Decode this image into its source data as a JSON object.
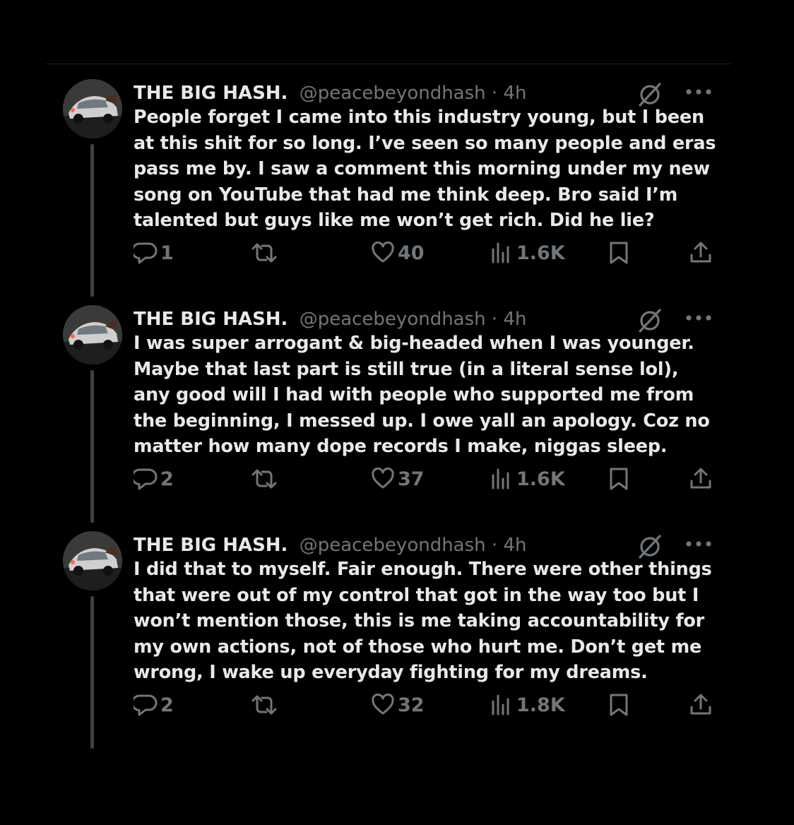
{
  "tweets": [
    {
      "name": "THE BIG HASH.",
      "handle": "@peacebeyondhash",
      "separator": "·",
      "time": "4h",
      "text": "People forget I came into this industry young, but I been\nat this shit for so long. I’ve seen so many people and eras\npass me by. I saw a comment this morning under my new\nsong on YouTube that had me think deep. Bro said I’m\ntalented but guys like me won’t get rich. Did he lie?",
      "replies": "1",
      "likes": "40",
      "views": "1.6K"
    },
    {
      "name": "THE BIG HASH.",
      "handle": "@peacebeyondhash",
      "separator": "·",
      "time": "4h",
      "text": "I was super arrogant & big-headed when I was younger.\nMaybe that last part is still true (in a literal sense lol),\nany good will I had with people who supported me from\nthe beginning, I messed up. I owe yall an apology. Coz no\nmatter how many dope records I make, niggas sleep.",
      "replies": "2",
      "likes": "37",
      "views": "1.6K"
    },
    {
      "name": "THE BIG HASH.",
      "handle": "@peacebeyondhash",
      "separator": "·",
      "time": "4h",
      "text": "I did that to myself. Fair enough. There were other things\nthat were out of my control that got in the way too but I\nwon’t mention those, this is me taking accountability for\nmy own actions, not of those who hurt me. Don’t get me\nwrong, I wake up everyday fighting for my dreams.",
      "replies": "2",
      "likes": "32",
      "views": "1.8K"
    }
  ],
  "icons": {
    "reply": "reply-icon",
    "retweet": "retweet-icon",
    "like": "heart-icon",
    "views": "views-icon",
    "bookmark": "bookmark-icon",
    "share": "share-icon",
    "grok": "grok-icon",
    "more": "more-icon"
  },
  "colors": {
    "background": "#000000",
    "text": "#e7e9ea",
    "secondary": "#71767b",
    "thread_line": "#3e4144"
  }
}
